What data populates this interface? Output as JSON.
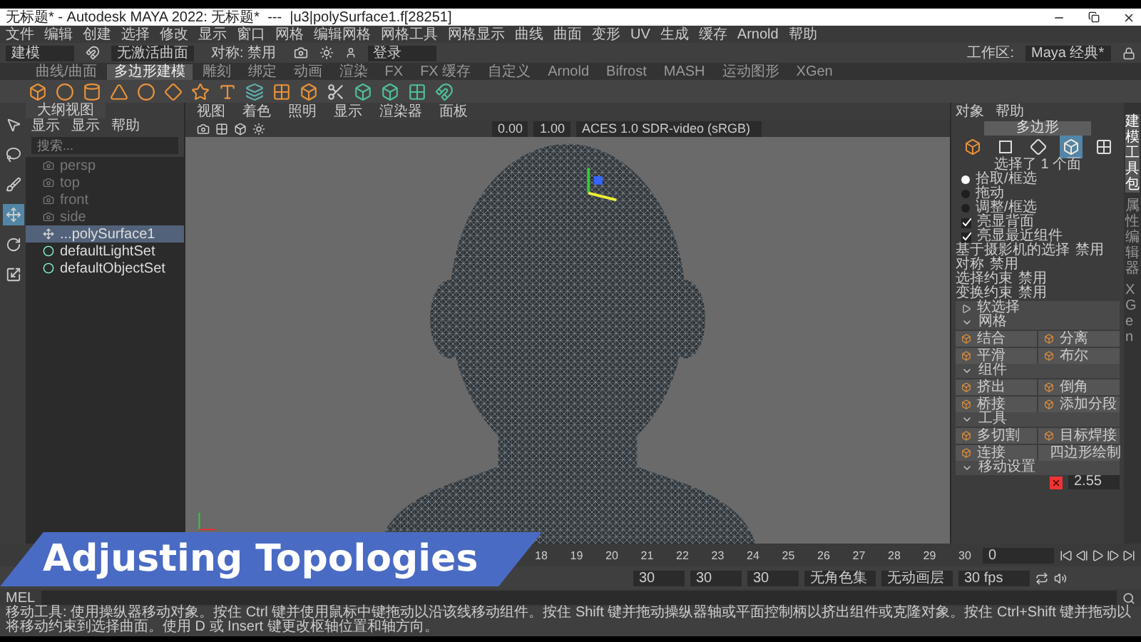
{
  "title_bar": {
    "title": "无标题* - Autodesk MAYA 2022: 无标题*  ---  |u3|polySurface1.f[28251]"
  },
  "menu_bar": [
    "文件",
    "编辑",
    "创建",
    "选择",
    "修改",
    "显示",
    "窗口",
    "网格",
    "编辑网格",
    "网格工具",
    "网格显示",
    "曲线",
    "曲面",
    "变形",
    "UV",
    "生成",
    "缓存",
    "Arnold",
    "帮助"
  ],
  "status_line": {
    "mode": "建模",
    "surface": "无激活曲面",
    "symmetry": "对称: 禁用",
    "login": "登录",
    "workspace_label": "工作区:",
    "workspace": "Maya 经典*"
  },
  "shelf_tabs": [
    {
      "label": "曲线/曲面",
      "selected": false
    },
    {
      "label": "多边形建模",
      "selected": true
    },
    {
      "label": "雕刻",
      "selected": false
    },
    {
      "label": "绑定",
      "selected": false
    },
    {
      "label": "动画",
      "selected": false
    },
    {
      "label": "渲染",
      "selected": false
    },
    {
      "label": "FX",
      "selected": false
    },
    {
      "label": "FX 缓存",
      "selected": false
    },
    {
      "label": "自定义",
      "selected": false
    },
    {
      "label": "Arnold",
      "selected": false
    },
    {
      "label": "Bifrost",
      "selected": false
    },
    {
      "label": "MASH",
      "selected": false
    },
    {
      "label": "运动图形",
      "selected": false
    },
    {
      "label": "XGen",
      "selected": false
    }
  ],
  "tools": [
    {
      "kind": "select",
      "selected": false
    },
    {
      "kind": "lasso",
      "selected": false
    },
    {
      "kind": "paint",
      "selected": false
    },
    {
      "kind": "move",
      "selected": true
    },
    {
      "kind": "rotate",
      "selected": false
    },
    {
      "kind": "scale",
      "selected": false
    }
  ],
  "outliner": {
    "title": "大纲视图",
    "menu": [
      "显示",
      "显示",
      "帮助"
    ],
    "search_placeholder": "搜索...",
    "items": [
      {
        "label": "persp",
        "kind": "camera",
        "dimmed": true,
        "selected": false
      },
      {
        "label": "top",
        "kind": "camera",
        "dimmed": true,
        "selected": false
      },
      {
        "label": "front",
        "kind": "camera",
        "dimmed": true,
        "selected": false
      },
      {
        "label": "side",
        "kind": "camera",
        "dimmed": true,
        "selected": false
      },
      {
        "label": "...polySurface1",
        "kind": "mesh",
        "dimmed": false,
        "selected": true
      },
      {
        "label": "defaultLightSet",
        "kind": "set",
        "dimmed": false,
        "selected": false
      },
      {
        "label": "defaultObjectSet",
        "kind": "set",
        "dimmed": false,
        "selected": false
      }
    ]
  },
  "viewport": {
    "menu": [
      "视图",
      "着色",
      "照明",
      "显示",
      "渲染器",
      "面板"
    ],
    "fields": [
      "0.00",
      "1.00"
    ],
    "color_space": "ACES 1.0 SDR-video (sRGB)"
  },
  "modeling_toolkit": {
    "menu": [
      "对象",
      "帮助"
    ],
    "mode_button": "多边形",
    "components": [
      {
        "kind": "object",
        "selected": false
      },
      {
        "kind": "vertex",
        "selected": false
      },
      {
        "kind": "edge",
        "selected": false
      },
      {
        "kind": "face",
        "selected": true
      },
      {
        "kind": "uv",
        "selected": false
      }
    ],
    "selection_info": "选择了 1 个面",
    "pick_modes": [
      {
        "label": "拾取/框选",
        "selected": true
      },
      {
        "label": "拖动",
        "selected": false
      },
      {
        "label": "调整/框选",
        "selected": false
      }
    ],
    "options": [
      {
        "label": "亮显背面",
        "checked": true
      },
      {
        "label": "亮显最近组件",
        "checked": true
      }
    ],
    "settings": [
      {
        "label": "基于摄影机的选择",
        "value": "禁用"
      },
      {
        "label": "对称",
        "value": "禁用"
      },
      {
        "label": "选择约束",
        "value": "禁用"
      },
      {
        "label": "变换约束",
        "value": "禁用"
      }
    ],
    "sections": [
      {
        "title": "软选择",
        "expanded": false
      },
      {
        "title": "网格",
        "expanded": true,
        "buttons": [
          "结合",
          "分离",
          "平滑",
          "布尔"
        ]
      },
      {
        "title": "组件",
        "expanded": true,
        "buttons": [
          "挤出",
          "倒角",
          "桥接",
          "添加分段"
        ]
      },
      {
        "title": "工具",
        "expanded": true,
        "buttons": [
          "多切割",
          "目标焊接",
          "连接",
          "四边形绘制"
        ]
      },
      {
        "title": "移动设置",
        "expanded": true
      }
    ],
    "move_value": "2.55"
  },
  "side_tabs": [
    {
      "label": "建模工具包",
      "selected": true
    },
    {
      "label": "属性编辑器",
      "selected": false
    },
    {
      "label": "XGen",
      "selected": false
    }
  ],
  "timeline": {
    "ticks": [
      "18",
      "19",
      "20",
      "21",
      "22",
      "23",
      "24",
      "25",
      "26",
      "27",
      "28",
      "29",
      "30"
    ],
    "current_frame": "0"
  },
  "range": {
    "fields": [
      "30",
      "30",
      "30"
    ],
    "character_set": "无角色集",
    "anim_layer": "无动画层",
    "fps": "30 fps"
  },
  "command_line": {
    "label": "MEL"
  },
  "help_line": "移动工具: 使用操纵器移动对象。按住 Ctrl 键并使用鼠标中键拖动以沿该线移动组件。按住 Shift 键并拖动操纵器轴或平面控制柄以挤出组件或克隆对象。按住 Ctrl+Shift 键并拖动以将移动约束到选择曲面。使用 D 或 Insert 键更改枢轴位置和轴方向。",
  "caption": "Adjusting Topologies"
}
